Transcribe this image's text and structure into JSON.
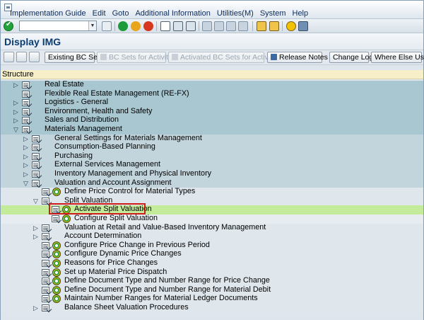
{
  "menubar": {
    "items": [
      "Implementation Guide",
      "Edit",
      "Goto",
      "Additional Information",
      "Utilities(M)",
      "System",
      "Help"
    ]
  },
  "system_toolbar": {
    "command_field_value": ""
  },
  "title": "Display IMG",
  "app_toolbar": {
    "buttons": [
      {
        "label": "Existing BC Sets",
        "enabled": true
      },
      {
        "label": "BC Sets for Activity",
        "enabled": false
      },
      {
        "label": "Activated BC Sets for Activity",
        "enabled": false
      },
      {
        "label": "Release Notes",
        "enabled": true
      },
      {
        "label": "Change Log",
        "enabled": true
      },
      {
        "label": "Where Else Used",
        "enabled": true
      }
    ]
  },
  "tree": {
    "header": "Structure",
    "rows": [
      {
        "label": "Real Estate",
        "level": 1,
        "expander": "collapsed",
        "activity": false
      },
      {
        "label": "Flexible Real Estate Management (RE-FX)",
        "level": 1,
        "expander": "none",
        "activity": false
      },
      {
        "label": "Logistics - General",
        "level": 1,
        "expander": "collapsed",
        "activity": false
      },
      {
        "label": "Environment, Health and Safety",
        "level": 1,
        "expander": "collapsed",
        "activity": false
      },
      {
        "label": "Sales and Distribution",
        "level": 1,
        "expander": "collapsed",
        "activity": false
      },
      {
        "label": "Materials Management",
        "level": 1,
        "expander": "expanded",
        "activity": false
      },
      {
        "label": "General Settings for Materials Management",
        "level": 2,
        "expander": "collapsed",
        "activity": false
      },
      {
        "label": "Consumption-Based Planning",
        "level": 2,
        "expander": "collapsed",
        "activity": false
      },
      {
        "label": "Purchasing",
        "level": 2,
        "expander": "collapsed",
        "activity": false
      },
      {
        "label": "External Services Management",
        "level": 2,
        "expander": "collapsed",
        "activity": false
      },
      {
        "label": "Inventory Management and Physical Inventory",
        "level": 2,
        "expander": "collapsed",
        "activity": false
      },
      {
        "label": "Valuation and Account Assignment",
        "level": 2,
        "expander": "expanded",
        "activity": false
      },
      {
        "label": "Define Price Control for Material Types",
        "level": 3,
        "expander": "none",
        "activity": true
      },
      {
        "label": "Split Valuation",
        "level": 3,
        "expander": "expanded",
        "activity": false
      },
      {
        "label": "Activate Split Valuation",
        "level": 4,
        "expander": "none",
        "activity": true,
        "selected": true
      },
      {
        "label": "Configure Split Valuation",
        "level": 4,
        "expander": "none",
        "activity": true
      },
      {
        "label": "Valuation at Retail and Value-Based Inventory Management",
        "level": 3,
        "expander": "collapsed",
        "activity": false
      },
      {
        "label": "Account Determination",
        "level": 3,
        "expander": "collapsed",
        "activity": false
      },
      {
        "label": "Configure Price Change in Previous Period",
        "level": 3,
        "expander": "none",
        "activity": true
      },
      {
        "label": "Configure Dynamic Price Changes",
        "level": 3,
        "expander": "none",
        "activity": true
      },
      {
        "label": "Reasons for Price Changes",
        "level": 3,
        "expander": "none",
        "activity": true
      },
      {
        "label": "Set up Material Price Dispatch",
        "level": 3,
        "expander": "none",
        "activity": true
      },
      {
        "label": "Define Document Type and Number Range for Price Change",
        "level": 3,
        "expander": "none",
        "activity": true
      },
      {
        "label": "Define Document Type and Number Range for Material Debit",
        "level": 3,
        "expander": "none",
        "activity": true
      },
      {
        "label": "Maintain Number Ranges for Material Ledger Documents",
        "level": 3,
        "expander": "none",
        "activity": true
      },
      {
        "label": "Balance Sheet Valuation Procedures",
        "level": 3,
        "expander": "collapsed",
        "activity": false
      }
    ]
  },
  "colors": {
    "level1_row": "#a9c7d1",
    "level2_row": "#c2d5dd",
    "selected_row": "#c3eb9a",
    "highlight_box": "#d11c1c"
  }
}
